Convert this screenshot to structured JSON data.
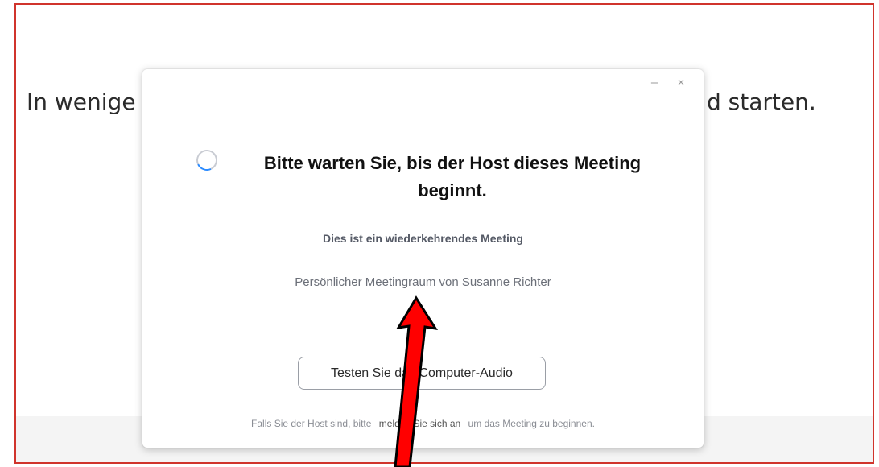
{
  "background": {
    "text_left": "In wenige",
    "text_right": "d starten."
  },
  "dialog": {
    "minimize_label": "–",
    "close_label": "×",
    "title": "Bitte warten Sie, bis der Host dieses Meeting beginnt.",
    "recurring_note": "Dies ist ein wiederkehrendes Meeting",
    "room_name": "Persönlicher Meetingraum von Susanne Richter",
    "audio_button": "Testen Sie das Computer-Audio",
    "footer_prefix": "Falls Sie der Host sind, bitte",
    "footer_link": "melden Sie sich an",
    "footer_suffix": "um das Meeting zu beginnen."
  },
  "colors": {
    "frame_border": "#d0342c",
    "spinner_accent": "#2d8cff",
    "annotation_arrow": "#ff0000"
  },
  "icons": [
    "spinner-icon",
    "minimize-icon",
    "close-icon",
    "annotation-arrow"
  ]
}
